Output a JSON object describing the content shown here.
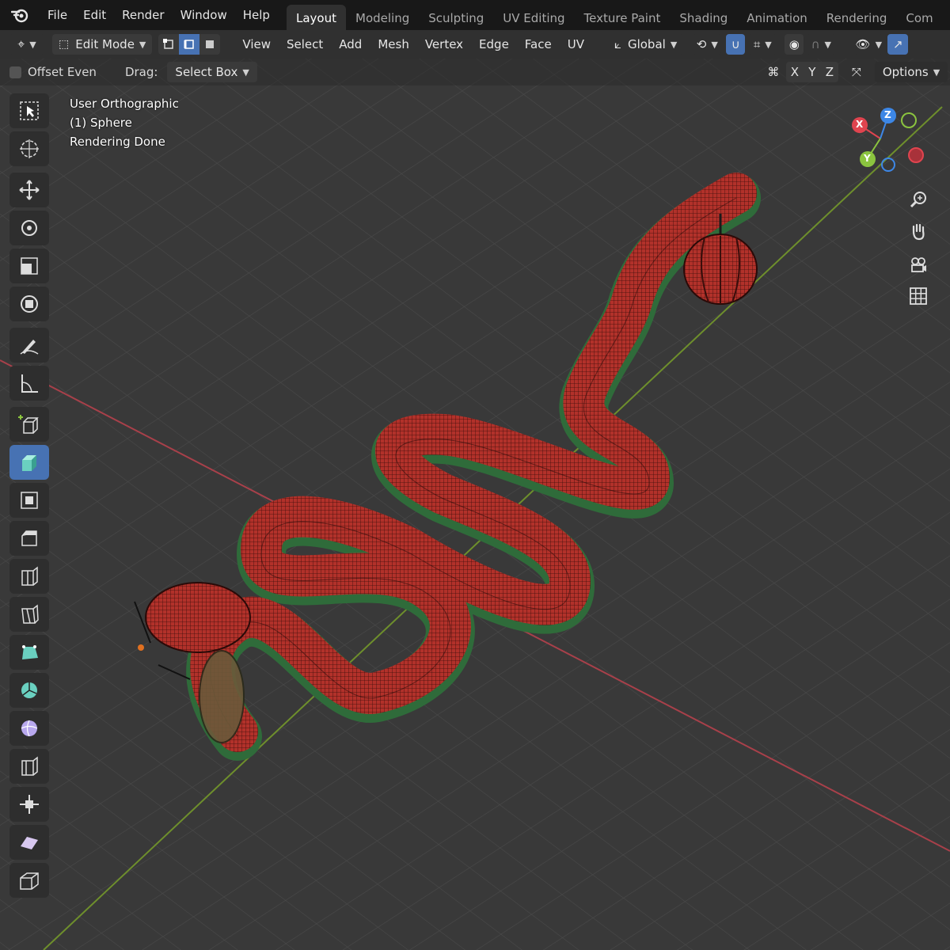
{
  "menu": {
    "items": [
      "File",
      "Edit",
      "Render",
      "Window",
      "Help"
    ]
  },
  "workspaces": {
    "tabs": [
      "Layout",
      "Modeling",
      "Sculpting",
      "UV Editing",
      "Texture Paint",
      "Shading",
      "Animation",
      "Rendering",
      "Com"
    ],
    "active": "Layout"
  },
  "header": {
    "mode": "Edit Mode",
    "menus": [
      "View",
      "Select",
      "Add",
      "Mesh",
      "Vertex",
      "Edge",
      "Face",
      "UV"
    ],
    "orientation": "Global"
  },
  "tool_settings": {
    "offset_even": "Offset Even",
    "drag_label": "Drag:",
    "drag_value": "Select Box",
    "axes": [
      "X",
      "Y",
      "Z"
    ],
    "options": "Options"
  },
  "viewport": {
    "view_name": "User Orthographic",
    "object": "(1) Sphere",
    "status": "Rendering Done"
  },
  "gizmo": {
    "x": "X",
    "y": "Y",
    "z": "Z",
    "colors": {
      "x": "#e0444f",
      "y": "#8bc43f",
      "z": "#3d87e6"
    }
  },
  "icons": {
    "toolbar": [
      "select-box-icon",
      "cursor-icon",
      "move-icon",
      "rotate-icon",
      "scale-icon",
      "transform-icon",
      "annotate-icon",
      "measure-icon",
      "add-cube-icon",
      "extrude-region-icon",
      "inset-faces-icon",
      "bevel-icon",
      "loop-cut-icon",
      "knife-icon",
      "poly-build-icon",
      "spin-icon",
      "smooth-icon",
      "edge-slide-icon",
      "shrink-fatten-icon",
      "shear-icon",
      "rip-region-icon"
    ],
    "nav": [
      "zoom-icon",
      "pan-hand-icon",
      "camera-icon",
      "grid-icon"
    ]
  },
  "colors": {
    "accent": "#4772b3",
    "mesh_red": "#b2312a",
    "mesh_green": "#2f6b3a"
  }
}
